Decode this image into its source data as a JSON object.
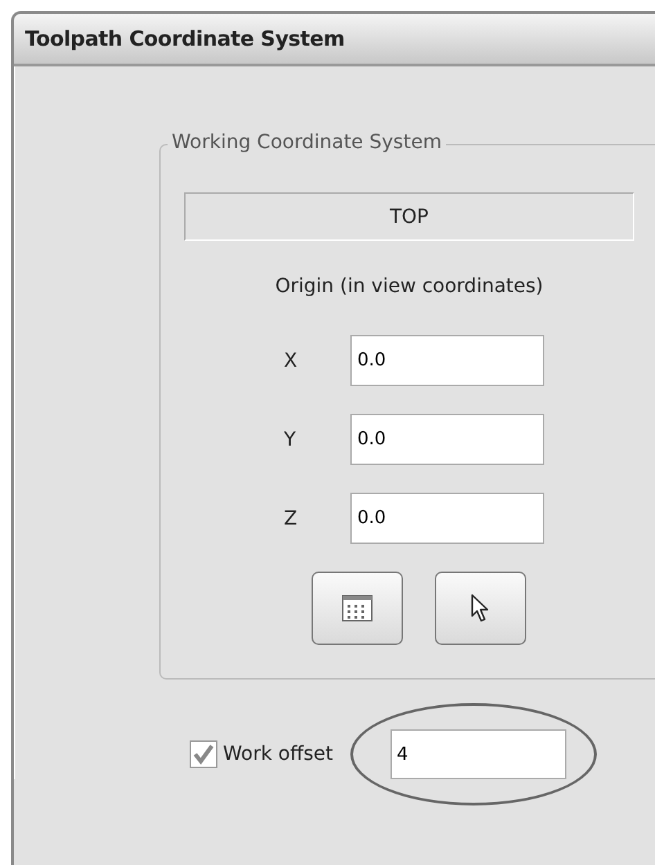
{
  "window": {
    "title": "Toolpath Coordinate System"
  },
  "group": {
    "legend": "Working Coordinate System",
    "view_name": "TOP",
    "origin_label": "Origin (in view coordinates)",
    "fields": [
      {
        "label": "X",
        "value": "0.0"
      },
      {
        "label": "Y",
        "value": "0.0"
      },
      {
        "label": "Z",
        "value": "0.0"
      }
    ],
    "buttons": [
      {
        "kind": "grid"
      },
      {
        "kind": "pointer"
      }
    ]
  },
  "work_offset": {
    "label": "Work offset",
    "checked": true,
    "value": "4",
    "highlighted": true
  }
}
